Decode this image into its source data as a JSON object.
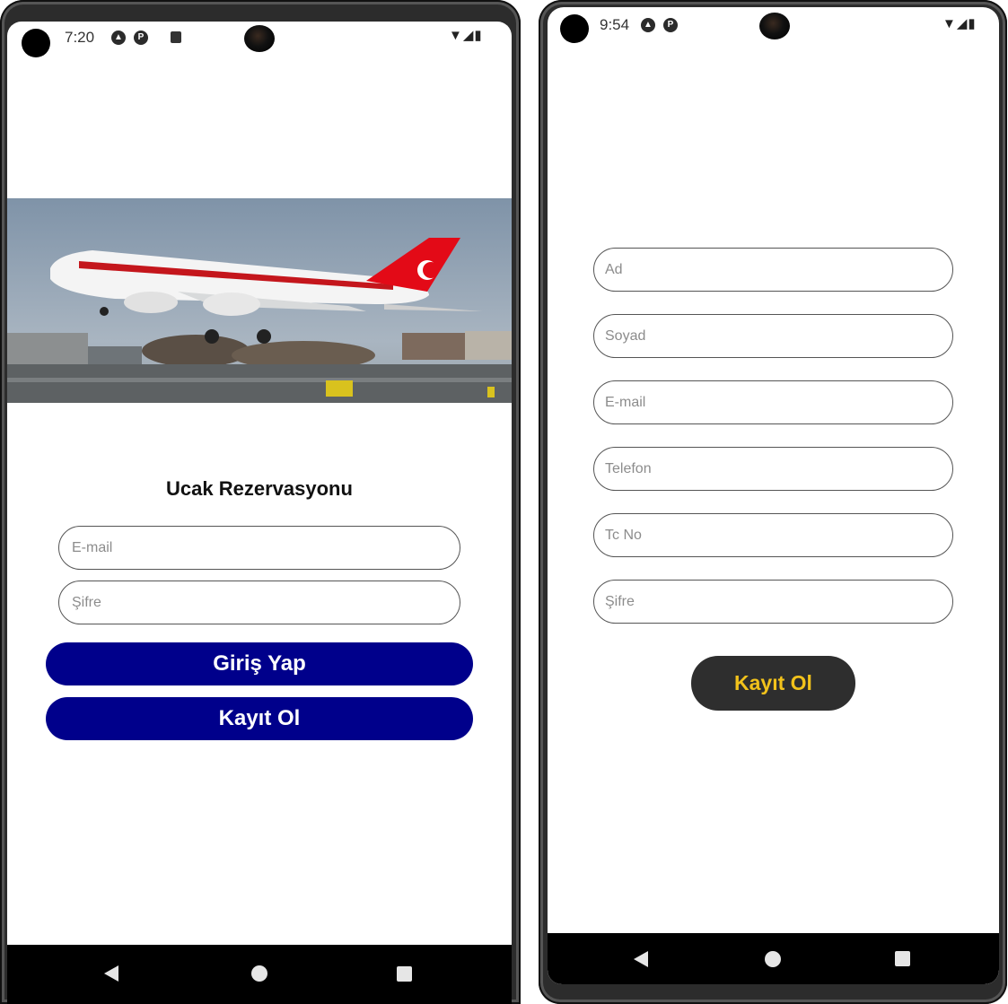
{
  "login_screen": {
    "status": {
      "time": "7:20",
      "icons": [
        "a-icon",
        "p-icon",
        "sd-card-icon"
      ],
      "right_icons": "wifi signal battery"
    },
    "title": "Ucak Rezervasyonu",
    "email_placeholder": "E-mail",
    "password_placeholder": "Şifre",
    "login_button": "Giriş Yap",
    "register_button": "Kayıt Ol"
  },
  "register_screen": {
    "status": {
      "time": "9:54",
      "icons": [
        "a-icon",
        "p-icon"
      ],
      "right_icons": "wifi signal battery"
    },
    "fields": [
      {
        "name": "first-name-field",
        "placeholder": "Ad"
      },
      {
        "name": "last-name-field",
        "placeholder": "Soyad"
      },
      {
        "name": "email-field",
        "placeholder": "E-mail"
      },
      {
        "name": "phone-field",
        "placeholder": "Telefon"
      },
      {
        "name": "tc-no-field",
        "placeholder": "Tc No"
      },
      {
        "name": "password-field",
        "placeholder": "Şifre"
      }
    ],
    "register_button": "Kayıt Ol"
  },
  "colors": {
    "login_button_bg": "#00008b",
    "register_button_bg": "#2e2e2e",
    "register_button_text": "#f2c21b",
    "navbar_bg": "#000000"
  }
}
